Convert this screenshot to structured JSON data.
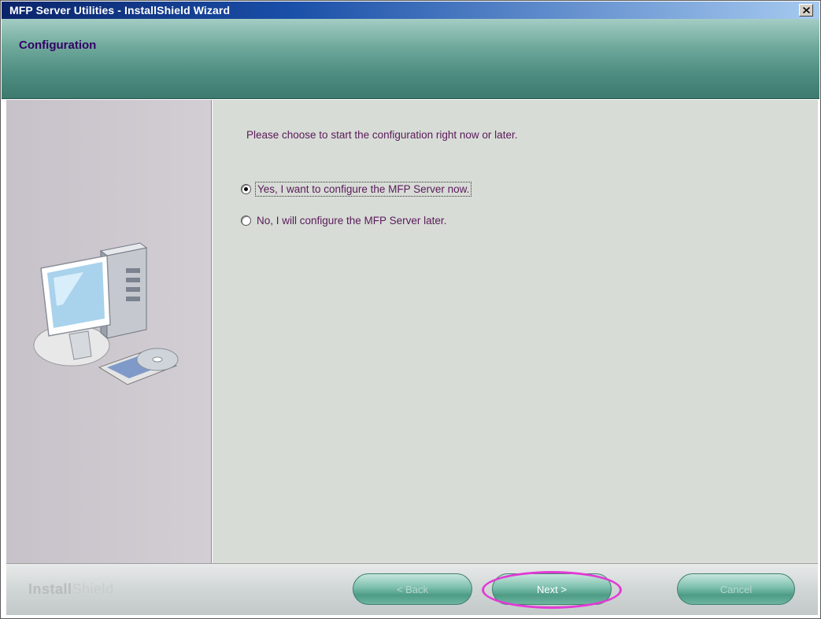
{
  "window": {
    "title": "MFP Server Utilities - InstallShield Wizard",
    "close_icon": "close-icon"
  },
  "header": {
    "title": "Configuration"
  },
  "main": {
    "prompt": "Please choose to start the configuration right now or later.",
    "options": [
      {
        "label": "Yes, I want to configure the MFP Server now.",
        "selected": true
      },
      {
        "label": "No, I will configure the MFP Server later.",
        "selected": false
      }
    ],
    "illustration": "computer-with-cd-icon"
  },
  "footer": {
    "brand_bold": "Install",
    "brand_light": "Shield",
    "back_label": "< Back",
    "next_label": "Next >",
    "cancel_label": "Cancel",
    "highlight_color": "#e23ad6"
  }
}
